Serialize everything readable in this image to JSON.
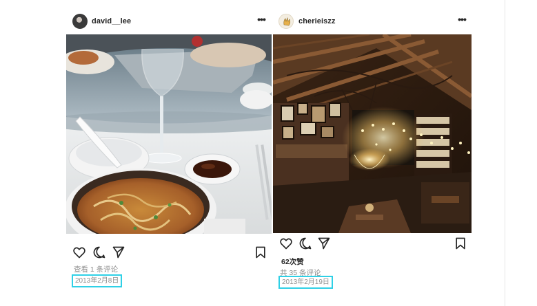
{
  "posts": [
    {
      "username": "david__lee",
      "comments_text": "查看 1 条评论",
      "date": "2013年2月8日",
      "more_glyph": "•••",
      "icons": [
        "avatar",
        "more-icon",
        "heart-icon",
        "comment-icon",
        "share-icon",
        "bookmark-icon"
      ]
    },
    {
      "username": "cherieiszz",
      "likes": "62次赞",
      "comments_text": "共 35 条评论",
      "date": "2013年2月19日",
      "more_glyph": "•••",
      "icons": [
        "avatar",
        "more-icon",
        "heart-icon",
        "comment-icon",
        "share-icon",
        "bookmark-icon"
      ]
    }
  ],
  "colors": {
    "date_highlight": "#2fd0e6",
    "text_primary": "#262626",
    "text_secondary": "#8e8e8e"
  }
}
